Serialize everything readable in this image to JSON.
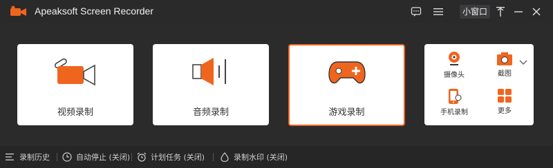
{
  "app": {
    "title": "Apeaksoft Screen Recorder"
  },
  "titlebar": {
    "mini_window_label": "小窗口"
  },
  "cards": [
    {
      "label": "视频录制",
      "icon": "video-camera-icon"
    },
    {
      "label": "音频录制",
      "icon": "speaker-icon"
    },
    {
      "label": "游戏录制",
      "icon": "gamepad-icon"
    }
  ],
  "more_panel": {
    "items": [
      {
        "label": "摄像头",
        "icon": "webcam-icon"
      },
      {
        "label": "截图",
        "icon": "camera-icon"
      },
      {
        "label": "手机录制",
        "icon": "phone-icon"
      },
      {
        "label": "更多",
        "icon": "grid-icon"
      }
    ]
  },
  "bottombar": {
    "history": "录制历史",
    "autostop": "自动停止 (关闭)",
    "schedule": "计划任务 (关闭)",
    "watermark": "录制水印 (关闭)"
  },
  "colors": {
    "accent": "#f0651e",
    "background": "#2b2b2c",
    "card": "#ffffff"
  }
}
